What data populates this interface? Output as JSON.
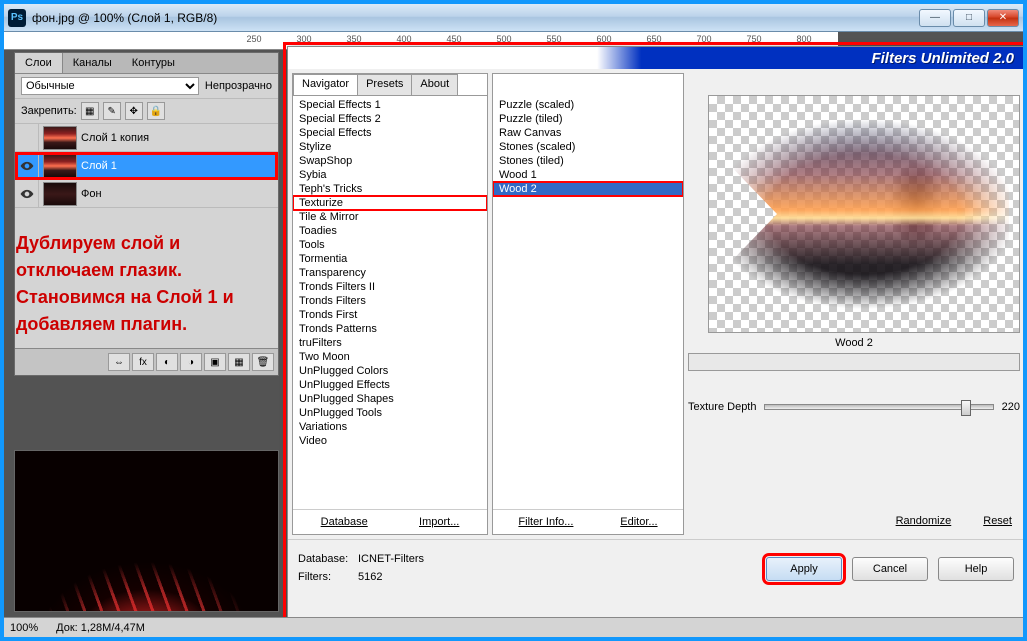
{
  "window": {
    "title": "фон.jpg @ 100% (Слой 1, RGB/8)",
    "ps_icon": "Ps"
  },
  "ruler_ticks": [
    "250",
    "300",
    "350",
    "400",
    "450",
    "500",
    "550",
    "600",
    "650",
    "700",
    "750",
    "800"
  ],
  "layers_panel": {
    "tabs": [
      "Слои",
      "Каналы",
      "Контуры"
    ],
    "blend_mode": "Обычные",
    "opacity_label": "Непрозрачно",
    "lock_label": "Закрепить:",
    "layers": [
      {
        "name": "Слой 1 копия",
        "eye": false
      },
      {
        "name": "Слой 1",
        "eye": true,
        "selected": true,
        "highlight": true
      },
      {
        "name": "Фон",
        "eye": true
      }
    ]
  },
  "tutorial_text": "Дублируем слой и отключаем глазик. Становимся на Слой 1 и добавляем плагин.",
  "dialog": {
    "banner": "Filters Unlimited 2.0",
    "tabs": [
      "Navigator",
      "Presets",
      "About"
    ],
    "categories": [
      "Special Effects 1",
      "Special Effects 2",
      "Special Effects",
      "Stylize",
      "SwapShop",
      "Sybia",
      "Teph's Tricks",
      "Texturize",
      "Tile & Mirror",
      "Toadies",
      "Tools",
      "Tormentia",
      "Transparency",
      "Tronds Filters II",
      "Tronds Filters",
      "Tronds First",
      "Tronds Patterns",
      "truFilters",
      "Two Moon",
      "UnPlugged Colors",
      "UnPlugged Effects",
      "UnPlugged Shapes",
      "UnPlugged Tools",
      "Variations",
      "Video"
    ],
    "category_selected_index": 7,
    "filters": [
      "Puzzle (scaled)",
      "Puzzle (tiled)",
      "Raw Canvas",
      "Stones (scaled)",
      "Stones (tiled)",
      "Wood 1",
      "Wood 2"
    ],
    "filter_selected_index": 6,
    "col1_buttons": [
      "Database",
      "Import..."
    ],
    "col2_buttons": [
      "Filter Info...",
      "Editor..."
    ],
    "col3_buttons": [
      "Randomize",
      "Reset"
    ],
    "preview_label": "Wood 2",
    "param_name": "Texture Depth",
    "param_value": "220",
    "footer": {
      "db_label": "Database:",
      "db_value": "ICNET-Filters",
      "filters_label": "Filters:",
      "filters_value": "5162",
      "apply": "Apply",
      "cancel": "Cancel",
      "help": "Help"
    }
  },
  "status": {
    "zoom": "100%",
    "doc": "Док: 1,28M/4,47M"
  }
}
